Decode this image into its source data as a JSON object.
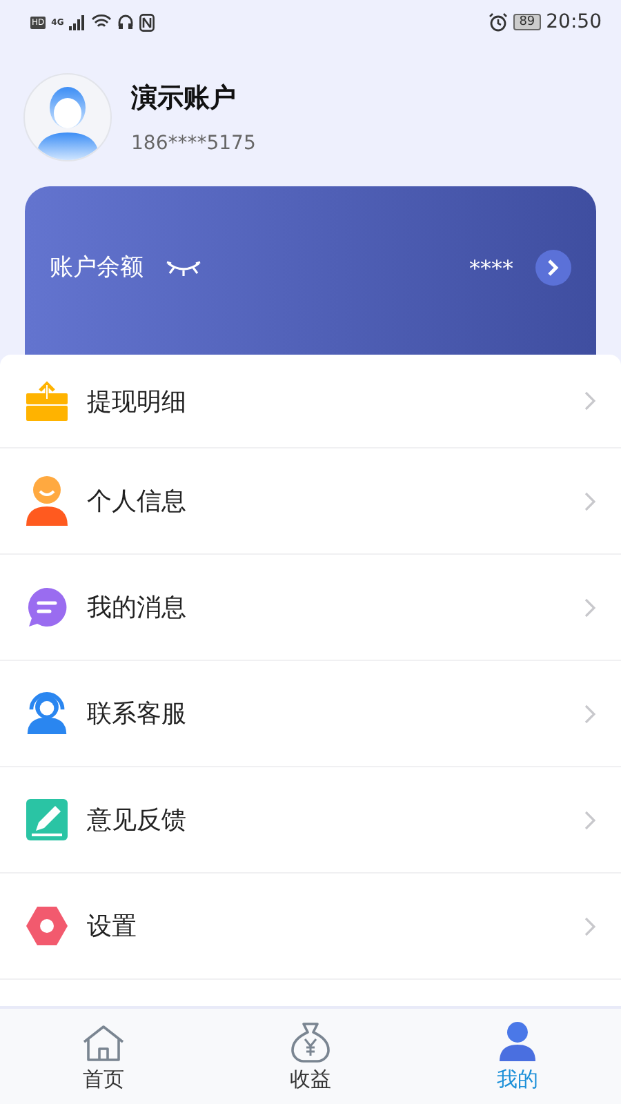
{
  "status_bar": {
    "hd": "HD",
    "network": "4G",
    "battery": "89",
    "time": "20:50"
  },
  "profile": {
    "name": "演示账户",
    "phone": "186****5175"
  },
  "balance_card": {
    "label": "账户余额",
    "amount": "****"
  },
  "menu": [
    {
      "kind": "withdraw",
      "label": "提现明细"
    },
    {
      "kind": "person",
      "label": "个人信息"
    },
    {
      "kind": "message",
      "label": "我的消息"
    },
    {
      "kind": "service",
      "label": "联系客服"
    },
    {
      "kind": "feedback",
      "label": "意见反馈"
    },
    {
      "kind": "settings",
      "label": "设置"
    }
  ],
  "tabs": [
    {
      "kind": "home",
      "label": "首页",
      "selected": false
    },
    {
      "kind": "income",
      "label": "收益",
      "selected": false
    },
    {
      "kind": "me",
      "label": "我的",
      "selected": true
    }
  ]
}
